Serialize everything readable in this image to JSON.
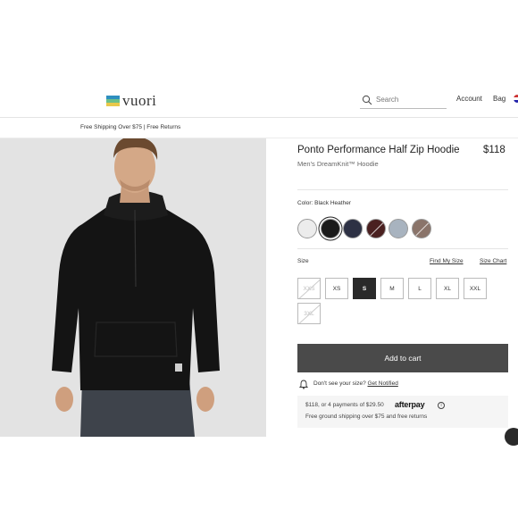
{
  "brand": {
    "name": "vuori",
    "logo_colors": [
      "#2f8fbf",
      "#6cbf8a",
      "#e8c84a"
    ]
  },
  "header": {
    "search_placeholder": "Search",
    "account_label": "Account",
    "bag_label": "Bag"
  },
  "promo": {
    "text": "Free Shipping Over $75 | Free Returns"
  },
  "product": {
    "title": "Ponto Performance Half Zip Hoodie",
    "price": "$118",
    "subtitle": "Men's DreamKnit™ Hoodie",
    "color_label": "Color: Black Heather",
    "swatches": [
      {
        "name": "Light Grey",
        "color": "#ececec",
        "selected": false,
        "slash": false
      },
      {
        "name": "Black Heather",
        "color": "#1a1a1a",
        "selected": true,
        "slash": false
      },
      {
        "name": "Navy",
        "color": "#2d3144",
        "selected": false,
        "slash": false
      },
      {
        "name": "Maroon",
        "color": "#4a2020",
        "selected": false,
        "slash": true
      },
      {
        "name": "Blue Grey",
        "color": "#a8b3bf",
        "selected": false,
        "slash": false
      },
      {
        "name": "Taupe",
        "color": "#8a746a",
        "selected": false,
        "slash": true
      }
    ],
    "size_label": "Size",
    "find_size_label": "Find My Size",
    "size_chart_label": "Size Chart",
    "sizes": [
      {
        "label": "XXS",
        "state": "unavailable"
      },
      {
        "label": "XS",
        "state": "available"
      },
      {
        "label": "S",
        "state": "selected"
      },
      {
        "label": "M",
        "state": "available"
      },
      {
        "label": "L",
        "state": "available"
      },
      {
        "label": "XL",
        "state": "available"
      },
      {
        "label": "XXL",
        "state": "available"
      },
      {
        "label": "3XL",
        "state": "unavailable"
      }
    ],
    "add_to_cart_label": "Add to cart",
    "notify_text": "Don't see your size?",
    "notify_link": "Get Notified",
    "afterpay_text": "$118, or 4 payments of $29.50",
    "afterpay_brand": "afterpay",
    "afterpay_info": "i",
    "shipping_text": "Free ground shipping over $75 and free returns"
  }
}
